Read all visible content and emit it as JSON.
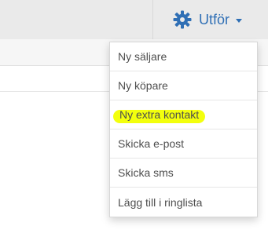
{
  "header": {
    "actions_button": {
      "label": "Utför",
      "icon": "gear-icon",
      "caret_icon": "caret-down-icon",
      "color": "#2f6fb5"
    }
  },
  "menu": {
    "items": [
      {
        "label": "Ny säljare"
      },
      {
        "label": "Ny köpare"
      },
      {
        "label": "Ny extra kontakt",
        "highlight_color": "#f2ff00"
      },
      {
        "label": "Skicka e-post"
      },
      {
        "label": "Skicka sms"
      },
      {
        "label": "Lägg till i ringlista"
      }
    ]
  }
}
